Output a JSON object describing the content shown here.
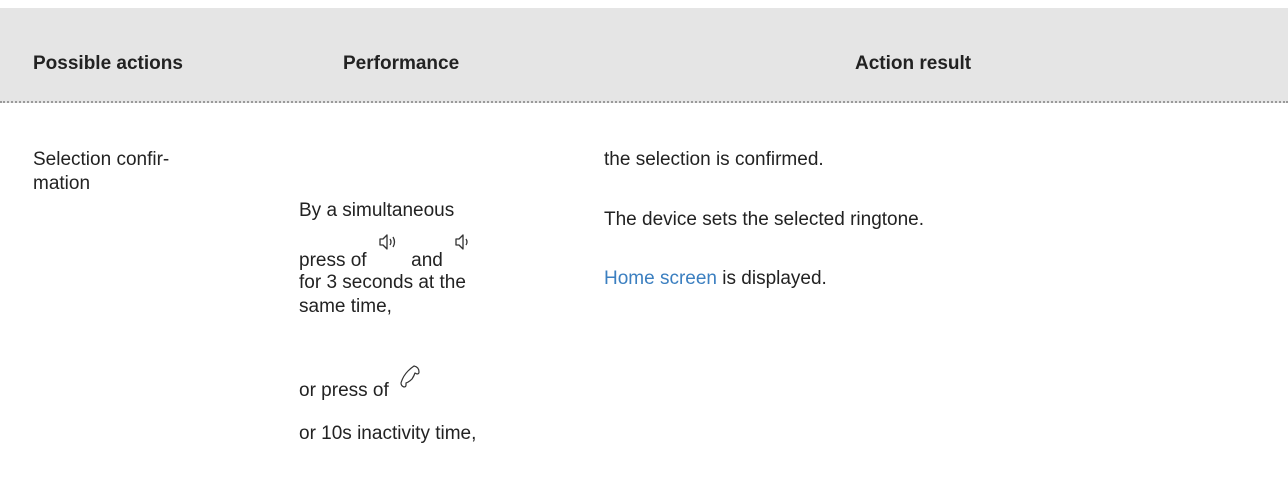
{
  "table": {
    "headers": {
      "possible_actions": "Possible actions",
      "performance": "Performance",
      "action_result": "Action result"
    },
    "row": {
      "action_line1": "Selection confir-",
      "action_line2": "mation",
      "performance": {
        "line1": "By a simultaneous",
        "press_of": "press of",
        "and": "and",
        "line3": "for 3 seconds at the",
        "line4": "same time,",
        "or_press_of": "or press of",
        "inactivity": "or 10s inactivity time,"
      },
      "result": {
        "line1": "the selection is confirmed.",
        "line2": "The device sets the selected ringtone.",
        "home_link": "Home screen",
        "line3_suffix": " is displayed."
      }
    }
  },
  "icons": {
    "volume_up": "volume-up-icon",
    "volume_down": "volume-down-icon",
    "handset": "handset-icon"
  }
}
